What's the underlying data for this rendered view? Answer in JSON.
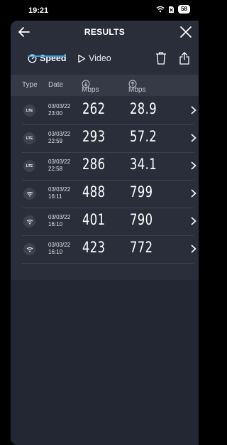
{
  "status_bar": {
    "time": "19:21",
    "battery": "58"
  },
  "header": {
    "title": "RESULTS"
  },
  "tabs": [
    {
      "label": "Speed",
      "active": true
    },
    {
      "label": "Video",
      "active": false
    }
  ],
  "columns": {
    "type": "Type",
    "date": "Date",
    "download": "Mbps",
    "upload": "Mbps"
  },
  "rows": [
    {
      "type": "LTE",
      "date": "03/03/22",
      "time": "23:00",
      "download": "262",
      "upload": "28.9"
    },
    {
      "type": "LTE",
      "date": "03/03/22",
      "time": "22:59",
      "download": "293",
      "upload": "57.2"
    },
    {
      "type": "LTE",
      "date": "03/03/22",
      "time": "22:58",
      "download": "286",
      "upload": "34.1"
    },
    {
      "type": "wifi",
      "date": "03/03/22",
      "time": "16:11",
      "download": "488",
      "upload": "799"
    },
    {
      "type": "wifi",
      "date": "03/03/22",
      "time": "16:10",
      "download": "401",
      "upload": "790"
    },
    {
      "type": "wifi",
      "date": "03/03/22",
      "time": "16:10",
      "download": "423",
      "upload": "772"
    }
  ],
  "colors": {
    "accent": "#3a9ee8",
    "sheet": "#2a2e3b",
    "header_bar": "#363a47"
  }
}
